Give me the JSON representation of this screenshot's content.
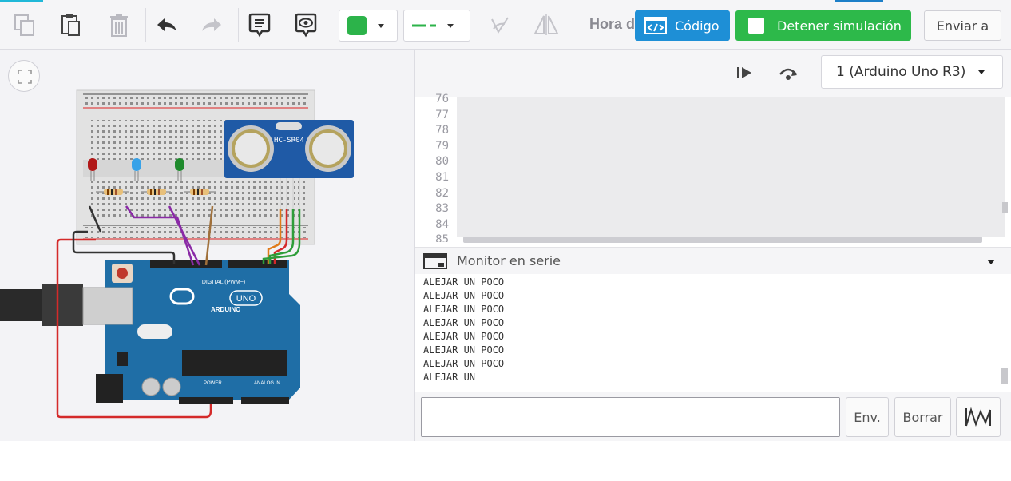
{
  "toolbar": {
    "hora_label": "Hora d",
    "code_label": "Código",
    "stop_sim_label": "Detener simulación",
    "send_label": "Enviar a",
    "colors": {
      "accent_blue": "#1e8fd6",
      "sim_green": "#2db94a",
      "wire_color": "#2cb34a"
    }
  },
  "device_selector": {
    "selected": "1 (Arduino Uno R3)"
  },
  "code_editor": {
    "line_numbers": [
      "76",
      "77",
      "78",
      "79",
      "80",
      "81",
      "82",
      "83",
      "84",
      "85"
    ]
  },
  "serial_monitor": {
    "title": "Monitor en serie",
    "lines": [
      "ALEJAR UN POCO",
      "ALEJAR UN POCO",
      "ALEJAR UN POCO",
      "ALEJAR UN POCO",
      "ALEJAR UN POCO",
      "ALEJAR UN POCO",
      "ALEJAR UN POCO",
      "ALEJAR UN"
    ],
    "input_value": "",
    "send_button": "Env.",
    "clear_button": "Borrar"
  },
  "circuit": {
    "sensor_label": "HC-SR04",
    "board_brand": "ARDUINO",
    "board_model": "UNO",
    "digital_label": "DIGITAL (PWM~)",
    "power_label": "POWER",
    "analog_label": "ANALOG IN"
  }
}
